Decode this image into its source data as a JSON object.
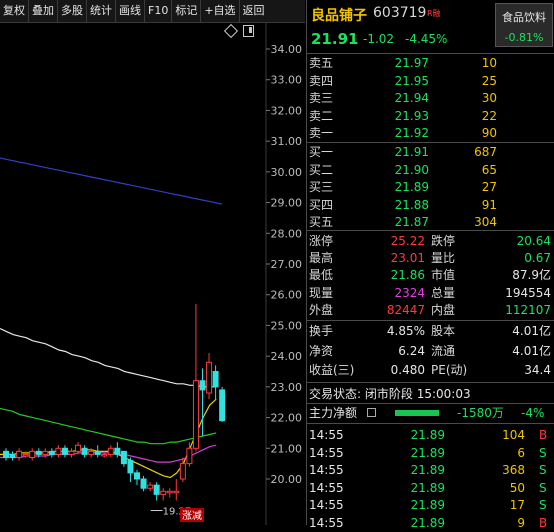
{
  "toolbar": [
    "复权",
    "叠加",
    "多股",
    "统计",
    "画线",
    "F10",
    "标记",
    "+自选",
    "返回"
  ],
  "stock": {
    "name": "良品铺子",
    "code": "603719",
    "badge": "R融",
    "price": "21.91",
    "change": "-1.02",
    "change_pct": "-4.45%",
    "sector": {
      "name": "食品饮料",
      "change_pct": "-0.81%"
    }
  },
  "order_book": {
    "asks": [
      {
        "label": "卖五",
        "price": "21.97",
        "volume": "10"
      },
      {
        "label": "卖四",
        "price": "21.95",
        "volume": "25"
      },
      {
        "label": "卖三",
        "price": "21.94",
        "volume": "30"
      },
      {
        "label": "卖二",
        "price": "21.93",
        "volume": "22"
      },
      {
        "label": "卖一",
        "price": "21.92",
        "volume": "90"
      }
    ],
    "bids": [
      {
        "label": "买一",
        "price": "21.91",
        "volume": "687"
      },
      {
        "label": "买二",
        "price": "21.90",
        "volume": "65"
      },
      {
        "label": "买三",
        "price": "21.89",
        "volume": "27"
      },
      {
        "label": "买四",
        "price": "21.88",
        "volume": "91"
      },
      {
        "label": "买五",
        "price": "21.87",
        "volume": "304"
      }
    ]
  },
  "stats": [
    {
      "l1": "涨停",
      "v1": "25.22",
      "c1": "red",
      "l2": "跌停",
      "v2": "20.64",
      "c2": "green"
    },
    {
      "l1": "最高",
      "v1": "23.01",
      "c1": "red",
      "l2": "量比",
      "v2": "0.67",
      "c2": "green"
    },
    {
      "l1": "最低",
      "v1": "21.86",
      "c1": "green",
      "l2": "市值",
      "v2": "87.9亿",
      "c2": "white"
    },
    {
      "l1": "现量",
      "v1": "2324",
      "c1": "magenta",
      "l2": "总量",
      "v2": "194554",
      "c2": "white"
    },
    {
      "l1": "外盘",
      "v1": "82447",
      "c1": "red",
      "l2": "内盘",
      "v2": "112107",
      "c2": "green"
    },
    {
      "l1": "换手",
      "v1": "4.85%",
      "c1": "white",
      "l2": "股本",
      "v2": "4.01亿",
      "c2": "white"
    },
    {
      "l1": "净资",
      "v1": "6.24",
      "c1": "white",
      "l2": "流通",
      "v2": "4.01亿",
      "c2": "white"
    },
    {
      "l1": "收益(三)",
      "v1": "0.480",
      "c1": "white",
      "l2": "PE(动)",
      "v2": "34.4",
      "c2": "white"
    }
  ],
  "status": {
    "label": "交易状态:",
    "value": "闭市阶段 15:00:03"
  },
  "main_flow": {
    "label": "主力净额",
    "amount": "-1580万",
    "pct": "-4%"
  },
  "ticks": [
    {
      "time": "14:55",
      "price": "21.89",
      "volume": "104",
      "dir": "B",
      "dir_color": "red"
    },
    {
      "time": "14:55",
      "price": "21.89",
      "volume": "6",
      "dir": "S",
      "dir_color": "green"
    },
    {
      "time": "14:55",
      "price": "21.89",
      "volume": "368",
      "dir": "S",
      "dir_color": "green"
    },
    {
      "time": "14:55",
      "price": "21.89",
      "volume": "50",
      "dir": "S",
      "dir_color": "green"
    },
    {
      "time": "14:55",
      "price": "21.89",
      "volume": "17",
      "dir": "S",
      "dir_color": "green"
    },
    {
      "time": "14:55",
      "price": "21.89",
      "volume": "9",
      "dir": "B",
      "dir_color": "red"
    }
  ],
  "colors": {
    "up": "#ff3a3a",
    "down": "#19e35a",
    "ma_white": "#e6e6e6",
    "ma_yellow": "#e6d200",
    "ma_green": "#22cc22",
    "ma_magenta": "#d040d0",
    "ma_blue": "#3040c0"
  },
  "chart_data": {
    "type": "candlestick",
    "y_ticks": [
      "34.00",
      "33.00",
      "32.00",
      "31.00",
      "30.00",
      "29.00",
      "28.00",
      "27.00",
      "26.00",
      "25.00",
      "24.00",
      "23.00",
      "22.00",
      "21.00",
      "20.00"
    ],
    "ylim": [
      19.5,
      34.5
    ],
    "low_annotation": "19.27",
    "marker_label": "涨减",
    "candles": [
      {
        "o": 20.9,
        "c": 20.7,
        "h": 21.0,
        "l": 20.6
      },
      {
        "o": 20.8,
        "c": 20.7,
        "h": 20.9,
        "l": 20.6
      },
      {
        "o": 20.7,
        "c": 20.9,
        "h": 21.0,
        "l": 20.6
      },
      {
        "o": 20.8,
        "c": 20.8,
        "h": 20.9,
        "l": 20.7
      },
      {
        "o": 20.7,
        "c": 20.9,
        "h": 21.0,
        "l": 20.6
      },
      {
        "o": 20.9,
        "c": 20.8,
        "h": 21.0,
        "l": 20.7
      },
      {
        "o": 20.8,
        "c": 20.9,
        "h": 21.0,
        "l": 20.7
      },
      {
        "o": 20.9,
        "c": 20.8,
        "h": 21.0,
        "l": 20.7
      },
      {
        "o": 20.8,
        "c": 21.0,
        "h": 21.1,
        "l": 20.7
      },
      {
        "o": 21.0,
        "c": 20.8,
        "h": 21.1,
        "l": 20.7
      },
      {
        "o": 20.8,
        "c": 20.9,
        "h": 21.0,
        "l": 20.7
      },
      {
        "o": 20.9,
        "c": 21.1,
        "h": 21.2,
        "l": 20.8
      },
      {
        "o": 21.0,
        "c": 20.8,
        "h": 21.1,
        "l": 20.7
      },
      {
        "o": 20.8,
        "c": 20.9,
        "h": 21.0,
        "l": 20.7
      },
      {
        "o": 20.9,
        "c": 20.8,
        "h": 21.1,
        "l": 20.7
      },
      {
        "o": 20.8,
        "c": 20.8,
        "h": 20.9,
        "l": 20.7
      },
      {
        "o": 20.8,
        "c": 21.0,
        "h": 21.1,
        "l": 20.7
      },
      {
        "o": 21.0,
        "c": 20.8,
        "h": 21.2,
        "l": 20.7
      },
      {
        "o": 20.9,
        "c": 20.5,
        "h": 20.9,
        "l": 20.4
      },
      {
        "o": 20.6,
        "c": 20.2,
        "h": 20.7,
        "l": 19.9
      },
      {
        "o": 20.2,
        "c": 20.0,
        "h": 20.3,
        "l": 19.8
      },
      {
        "o": 20.0,
        "c": 19.7,
        "h": 20.1,
        "l": 19.6
      },
      {
        "o": 19.7,
        "c": 19.8,
        "h": 19.9,
        "l": 19.6
      },
      {
        "o": 19.8,
        "c": 19.5,
        "h": 19.9,
        "l": 19.3
      },
      {
        "o": 19.5,
        "c": 19.6,
        "h": 19.7,
        "l": 19.3
      },
      {
        "o": 19.6,
        "c": 19.6,
        "h": 19.7,
        "l": 19.4
      },
      {
        "o": 19.6,
        "c": 19.6,
        "h": 20.0,
        "l": 19.3
      },
      {
        "o": 20.0,
        "c": 20.5,
        "h": 20.7,
        "l": 19.9
      },
      {
        "o": 20.5,
        "c": 21.0,
        "h": 21.2,
        "l": 20.4
      },
      {
        "o": 21.0,
        "c": 23.2,
        "h": 25.7,
        "l": 20.9
      },
      {
        "o": 23.2,
        "c": 22.9,
        "h": 23.6,
        "l": 21.4
      },
      {
        "o": 22.8,
        "c": 23.8,
        "h": 24.1,
        "l": 22.6
      },
      {
        "o": 23.5,
        "c": 23.0,
        "h": 23.7,
        "l": 22.6
      },
      {
        "o": 22.9,
        "c": 21.9,
        "h": 23.0,
        "l": 21.86
      }
    ],
    "ma_blue": [
      30.45,
      30.4,
      30.35,
      30.3,
      30.25,
      30.2,
      30.15,
      30.1,
      30.05,
      30.0,
      29.95,
      29.9,
      29.85,
      29.8,
      29.75,
      29.7,
      29.65,
      29.6,
      29.55,
      29.5,
      29.45,
      29.4,
      29.35,
      29.3,
      29.25,
      29.2,
      29.15,
      29.1,
      29.05,
      29.0,
      28.95
    ],
    "ma_white": [
      24.9,
      24.8,
      24.7,
      24.65,
      24.6,
      24.5,
      24.45,
      24.4,
      24.3,
      24.2,
      24.15,
      24.05,
      24.0,
      23.95,
      23.85,
      23.8,
      23.7,
      23.65,
      23.6,
      23.5,
      23.45,
      23.4,
      23.35,
      23.3,
      23.25,
      23.2,
      23.15,
      23.1,
      23.1,
      23.05,
      23.05,
      23.0,
      23.0,
      23.0
    ],
    "ma_green": [
      22.3,
      22.25,
      22.2,
      22.1,
      22.05,
      22.0,
      21.95,
      21.9,
      21.85,
      21.8,
      21.75,
      21.7,
      21.65,
      21.6,
      21.55,
      21.5,
      21.45,
      21.4,
      21.35,
      21.3,
      21.25,
      21.2,
      21.2,
      21.15,
      21.15,
      21.15,
      21.2,
      21.2,
      21.25,
      21.3,
      21.35,
      21.4,
      21.45,
      21.5
    ],
    "ma_yellow": [
      20.8,
      20.8,
      20.8,
      20.85,
      20.85,
      20.85,
      20.85,
      20.85,
      20.9,
      20.9,
      20.9,
      20.9,
      20.95,
      20.95,
      20.95,
      20.9,
      20.9,
      20.9,
      20.8,
      20.7,
      20.6,
      20.5,
      20.4,
      20.3,
      20.2,
      20.1,
      20.05,
      20.2,
      20.5,
      21.0,
      21.5,
      22.0,
      22.4,
      22.6
    ],
    "ma_magenta": [
      20.7,
      20.7,
      20.7,
      20.7,
      20.75,
      20.75,
      20.75,
      20.75,
      20.8,
      20.8,
      20.8,
      20.8,
      20.85,
      20.85,
      20.85,
      20.85,
      20.85,
      20.85,
      20.8,
      20.8,
      20.75,
      20.7,
      20.65,
      20.6,
      20.55,
      20.55,
      20.55,
      20.6,
      20.65,
      20.75,
      20.85,
      20.95,
      21.05,
      21.1
    ]
  }
}
